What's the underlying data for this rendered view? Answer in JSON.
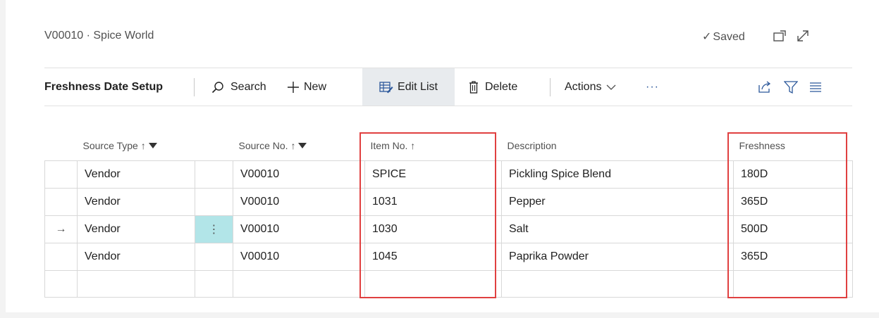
{
  "header": {
    "title": "V00010 · Spice World",
    "saved_label": "Saved",
    "open_new_window_icon": "open-in-new-window-icon",
    "expand_icon": "expand-icon"
  },
  "actionbar": {
    "page_name": "Freshness Date Setup",
    "search_label": "Search",
    "new_label": "New",
    "edit_list_label": "Edit List",
    "delete_label": "Delete",
    "actions_label": "Actions",
    "more_label": "···"
  },
  "table": {
    "columns": {
      "source_type": "Source Type",
      "source_no": "Source No.",
      "item_no": "Item No.",
      "description": "Description",
      "freshness": "Freshness"
    },
    "sort_arrow": "↑",
    "row_indicator": "→",
    "row_menu": "⋮",
    "rows": [
      {
        "source_type": "Vendor",
        "source_no": "V00010",
        "item_no": "SPICE",
        "description": "Pickling Spice Blend",
        "freshness": "180D"
      },
      {
        "source_type": "Vendor",
        "source_no": "V00010",
        "item_no": "1031",
        "description": "Pepper",
        "freshness": "365D"
      },
      {
        "source_type": "Vendor",
        "source_no": "V00010",
        "item_no": "1030",
        "description": "Salt",
        "freshness": "500D"
      },
      {
        "source_type": "Vendor",
        "source_no": "V00010",
        "item_no": "1045",
        "description": "Paprika Powder",
        "freshness": "365D"
      }
    ],
    "selected_row": 3
  },
  "colors": {
    "highlight": "#e04040",
    "selected_cell": "#b2e5e8",
    "active_button": "#e8ebee",
    "accent": "#008489"
  }
}
